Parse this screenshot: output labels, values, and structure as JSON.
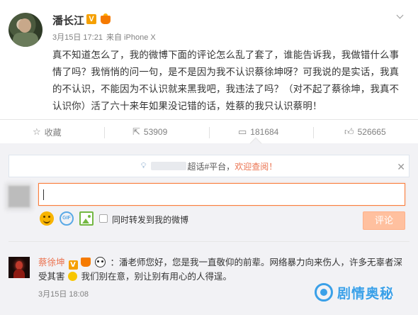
{
  "post": {
    "author": "潘长江",
    "date": "3月15日 17:21",
    "source": "来自 iPhone X",
    "text": "真不知道怎么了，我的微博下面的评论怎么乱了套了，谁能告诉我，我做错什么事情了吗？我悄悄的问一句，是不是因为我不认识蔡徐坤呀？可我说的是实话，我真的不认识，不能因为不认识就来黑我吧，我违法了吗？（对不起了蔡徐坤，我真不认识你）活了六十来年如果没记错的话，姓蔡的我只认识蔡明！"
  },
  "actions": {
    "favorite_label": "收藏",
    "repost_count": "53909",
    "comment_count": "181684",
    "like_count": "526665"
  },
  "notice": {
    "prefix": "",
    "suffix": "超话#平台，",
    "highlight": "欢迎查阅！"
  },
  "composer": {
    "repost_option": "同时转发到我的微博",
    "submit_label": "评论"
  },
  "comment": {
    "author": "蔡徐坤",
    "text_part1": "：潘老师您好，您是我一直敬仰的前辈。网络暴力向来伤人，许多无辜者深受其害",
    "text_part2": "我们别在意，别让别有用心的人得逞。",
    "time": "3月15日 18:08"
  },
  "watermark": {
    "text": "剧情奥秘"
  },
  "icons": {
    "v_badge": "V",
    "gif": "GIF"
  },
  "colors": {
    "accent": "#eb7350",
    "badge": "#f5a000",
    "input_border": "#fa7d3c",
    "submit_bg": "#ffc09f",
    "watermark": "#3aa0e8"
  }
}
